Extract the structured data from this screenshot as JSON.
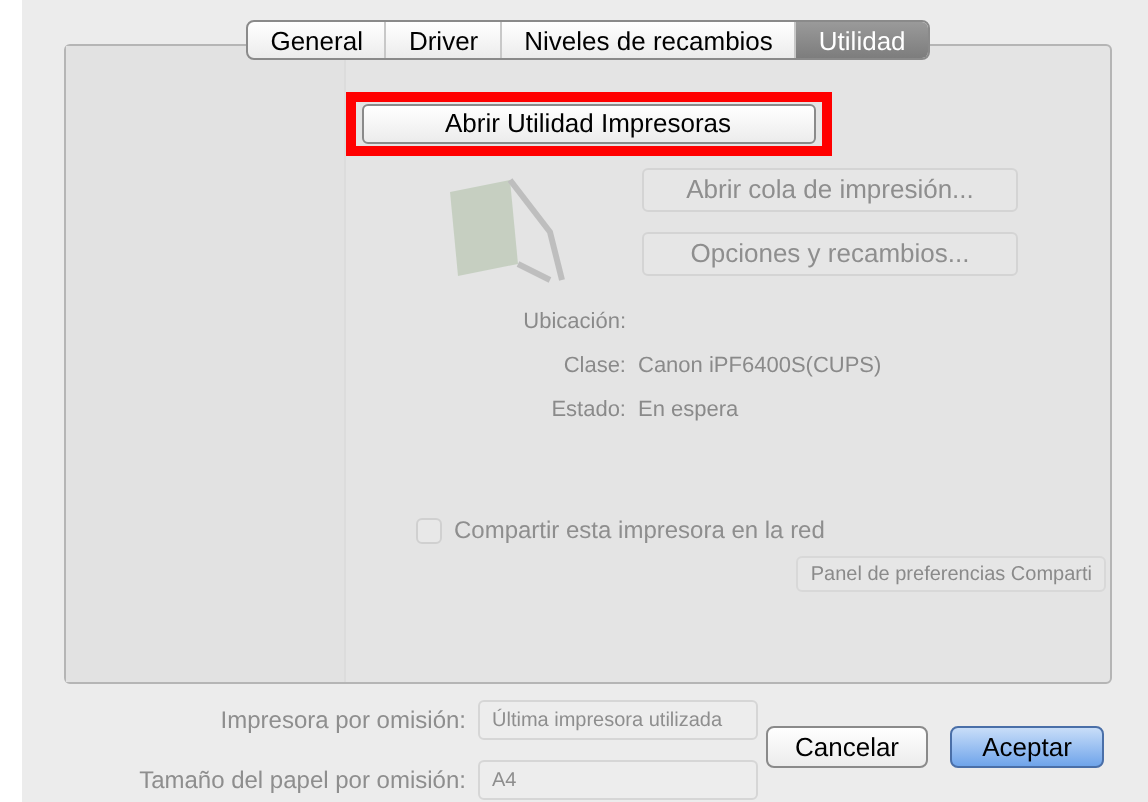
{
  "tabs": [
    {
      "label": "General",
      "selected": false
    },
    {
      "label": "Driver",
      "selected": false
    },
    {
      "label": "Niveles de recambios",
      "selected": false
    },
    {
      "label": "Utilidad",
      "selected": true
    }
  ],
  "open_utility_button": {
    "label": "Abrir Utilidad Impresoras",
    "highlighted": true
  },
  "printer_buttons": [
    "Abrir cola de impresión...",
    "Opciones y recambios..."
  ],
  "details": [
    {
      "label": "Ubicación:"
    },
    {
      "label": "Clase:",
      "value": "Canon iPF6400S(CUPS)"
    },
    {
      "label": "Estado:",
      "value": "En espera"
    }
  ],
  "share": {
    "label": "Compartir esta impresora en la red",
    "checked": false,
    "prefs_button": "Panel de preferencias Comparti"
  },
  "defaults": [
    {
      "label": "Impresora por omisión:",
      "value": "Última impresora utilizada"
    },
    {
      "label": "Tamaño del papel por omisión:",
      "value": "A4"
    }
  ],
  "buttons": [
    {
      "label": "Cancelar",
      "default": false
    },
    {
      "label": "Aceptar",
      "default": true
    }
  ]
}
